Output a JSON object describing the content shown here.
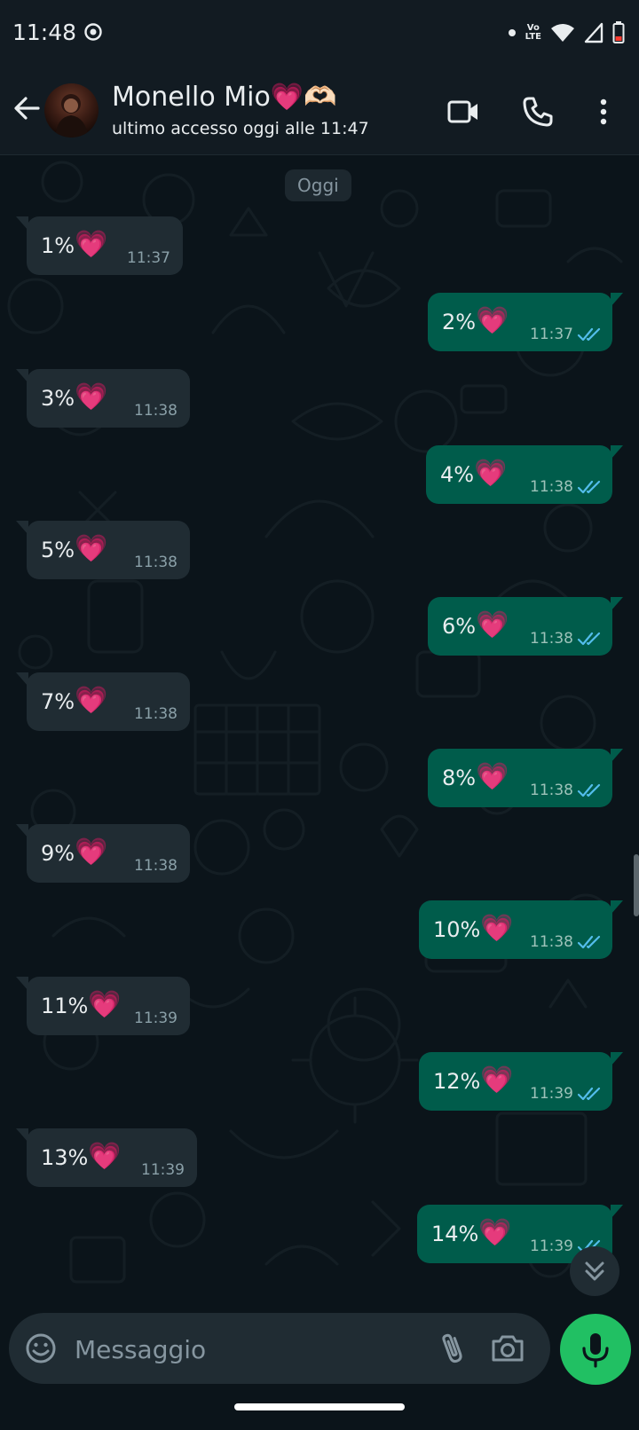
{
  "status_bar": {
    "time": "11:48",
    "network_label_top": "Vo",
    "network_label_bottom": "LTE"
  },
  "header": {
    "contact_name": "Monello Mio💗🫶🏻",
    "contact_status": "ultimo accesso oggi alle 11:47"
  },
  "chat": {
    "date_chip": "Oggi",
    "messages": [
      {
        "direction": "in",
        "text": "1%",
        "emoji": "💗",
        "time": "11:37"
      },
      {
        "direction": "out",
        "text": "2%",
        "emoji": "💗",
        "time": "11:37",
        "status": "read"
      },
      {
        "direction": "in",
        "text": "3%",
        "emoji": "💗",
        "time": "11:38"
      },
      {
        "direction": "out",
        "text": "4%",
        "emoji": "💗",
        "time": "11:38",
        "status": "read"
      },
      {
        "direction": "in",
        "text": "5%",
        "emoji": "💗",
        "time": "11:38"
      },
      {
        "direction": "out",
        "text": "6%",
        "emoji": "💗",
        "time": "11:38",
        "status": "read"
      },
      {
        "direction": "in",
        "text": "7%",
        "emoji": "💗",
        "time": "11:38"
      },
      {
        "direction": "out",
        "text": "8%",
        "emoji": "💗",
        "time": "11:38",
        "status": "read"
      },
      {
        "direction": "in",
        "text": "9%",
        "emoji": "💗",
        "time": "11:38"
      },
      {
        "direction": "out",
        "text": "10%",
        "emoji": "💗",
        "time": "11:38",
        "status": "read"
      },
      {
        "direction": "in",
        "text": "11%",
        "emoji": "💗",
        "time": "11:39"
      },
      {
        "direction": "out",
        "text": "12%",
        "emoji": "💗",
        "time": "11:39",
        "status": "read"
      },
      {
        "direction": "in",
        "text": "13%",
        "emoji": "💗",
        "time": "11:39"
      },
      {
        "direction": "out",
        "text": "14%",
        "emoji": "💗",
        "time": "11:39",
        "status": "read"
      }
    ]
  },
  "composer": {
    "placeholder": "Messaggio"
  },
  "icons": {
    "status": [
      "screen-record-icon",
      "dot-icon",
      "wifi-icon",
      "signal-icon",
      "battery-icon"
    ],
    "header": [
      "back-arrow-icon",
      "video-call-icon",
      "phone-icon",
      "more-vertical-icon"
    ],
    "composer": [
      "emoji-icon",
      "attach-icon",
      "camera-icon",
      "mic-icon"
    ],
    "chat": [
      "double-check-icon",
      "double-chevron-down-icon"
    ]
  },
  "colors": {
    "background": "#0b141a",
    "header": "#121b22",
    "incoming_bubble": "#202c33",
    "outgoing_bubble": "#005c4b",
    "read_ticks": "#53bdeb",
    "mic_button": "#21c063"
  }
}
